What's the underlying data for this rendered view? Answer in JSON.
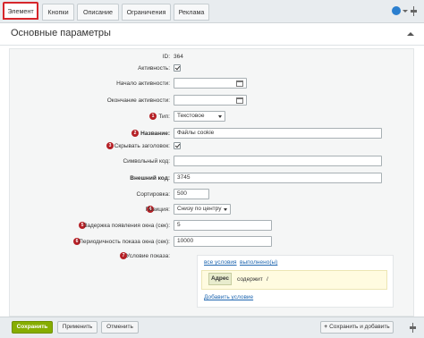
{
  "tabs": [
    {
      "label": "Элемент",
      "active": true
    },
    {
      "label": "Кнопки",
      "active": false
    },
    {
      "label": "Описание",
      "active": false
    },
    {
      "label": "Ограничения",
      "active": false
    },
    {
      "label": "Реклама",
      "active": false
    }
  ],
  "section": {
    "title": "Основные параметры"
  },
  "form": {
    "id": {
      "label": "ID:",
      "value": "364"
    },
    "active": {
      "label": "Активность:",
      "checked": true
    },
    "start": {
      "label": "Начало активности:",
      "value": ""
    },
    "end": {
      "label": "Окончание активности:",
      "value": ""
    },
    "type": {
      "badge": "1",
      "label": "Тип:",
      "value": "Текстовое"
    },
    "name": {
      "badge": "2",
      "label": "Название:",
      "value": "Файлы cookie"
    },
    "hide_title": {
      "badge": "3",
      "label": "Скрывать заголовок:",
      "checked": true
    },
    "symbolic_code": {
      "label": "Символьный код:",
      "value": ""
    },
    "external_code": {
      "label": "Внешний код:",
      "value": "3745"
    },
    "sort": {
      "label": "Сортировка:",
      "value": "500"
    },
    "position": {
      "badge": "4",
      "label": "Позиция:",
      "value": "Снизу по центру"
    },
    "delay": {
      "badge": "5",
      "label": "Задержка появления окна (сек):",
      "value": "5"
    },
    "period": {
      "badge": "6",
      "label": "Периодичность показа окна (сек):",
      "value": "10000"
    },
    "condition": {
      "badge": "7",
      "label": "Условие показа:"
    }
  },
  "condition_box": {
    "all_conditions": "все условия",
    "fulfilled": "выполнено(ы)",
    "field": "Адрес",
    "operator": "содержит",
    "value": "/",
    "add": "Добавить условие"
  },
  "footer": {
    "save": "Сохранить",
    "apply": "Применить",
    "cancel": "Отменить",
    "save_add": "Сохранить и добавить"
  },
  "colors": {
    "primary_button": "#86ad00",
    "active_tab_border": "#d6262b",
    "badge": "#b52026",
    "link": "#2067b0"
  }
}
